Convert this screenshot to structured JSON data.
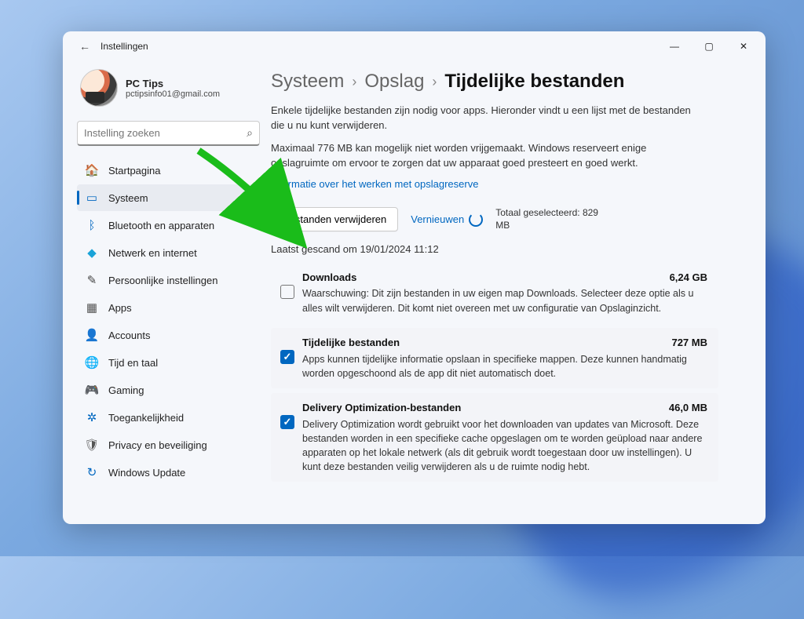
{
  "window": {
    "title": "Instellingen"
  },
  "profile": {
    "name": "PC Tips",
    "email": "pctipsinfo01@gmail.com"
  },
  "search": {
    "placeholder": "Instelling zoeken"
  },
  "nav": [
    {
      "label": "Startpagina",
      "icon": "🏠",
      "color": "#e67e22"
    },
    {
      "label": "Systeem",
      "icon": "▭",
      "color": "#0067c0",
      "selected": true
    },
    {
      "label": "Bluetooth en apparaten",
      "icon": "ᛒ",
      "color": "#0067c0"
    },
    {
      "label": "Netwerk en internet",
      "icon": "◆",
      "color": "#1aa3d8"
    },
    {
      "label": "Persoonlijke instellingen",
      "icon": "✎",
      "color": "#444"
    },
    {
      "label": "Apps",
      "icon": "▦",
      "color": "#555"
    },
    {
      "label": "Accounts",
      "icon": "👤",
      "color": "#2e8b57"
    },
    {
      "label": "Tijd en taal",
      "icon": "🌐",
      "color": "#555"
    },
    {
      "label": "Gaming",
      "icon": "🎮",
      "color": "#555"
    },
    {
      "label": "Toegankelijkheid",
      "icon": "✲",
      "color": "#0067c0"
    },
    {
      "label": "Privacy en beveiliging",
      "icon": "🛡",
      "color": "#555"
    },
    {
      "label": "Windows Update",
      "icon": "↻",
      "color": "#0067c0"
    }
  ],
  "breadcrumb": {
    "p1": "Systeem",
    "p2": "Opslag",
    "current": "Tijdelijke bestanden"
  },
  "intro1": "Enkele tijdelijke bestanden zijn nodig voor apps. Hieronder vindt u een lijst met de bestanden die u nu kunt verwijderen.",
  "intro2": "Maximaal 776 MB kan mogelijk niet worden vrijgemaakt. Windows reserveert enige opslagruimte om ervoor te zorgen dat uw apparaat goed presteert en goed werkt.",
  "reserve_link": "Informatie over het werken met opslagreserve",
  "actions": {
    "remove": "Bestanden verwijderen",
    "refresh": "Vernieuwen",
    "total_label": "Totaal geselecteerd: 829 MB"
  },
  "scan": "Laatst gescand om 19/01/2024 11:12",
  "items": [
    {
      "title": "Downloads",
      "size": "6,24 GB",
      "desc": "Waarschuwing: Dit zijn bestanden in uw eigen map Downloads. Selecteer deze optie als u alles wilt verwijderen. Dit komt niet overeen met uw configuratie van Opslaginzicht.",
      "checked": false
    },
    {
      "title": "Tijdelijke bestanden",
      "size": "727 MB",
      "desc": "Apps kunnen tijdelijke informatie opslaan in specifieke mappen. Deze kunnen handmatig worden opgeschoond als de app dit niet automatisch doet.",
      "checked": true
    },
    {
      "title": "Delivery Optimization-bestanden",
      "size": "46,0 MB",
      "desc": "Delivery Optimization wordt gebruikt voor het downloaden van updates van Microsoft. Deze bestanden worden in een specifieke cache opgeslagen om te worden geüpload naar andere apparaten op het lokale netwerk (als dit gebruik wordt toegestaan door uw instellingen). U kunt deze bestanden veilig verwijderen als u de ruimte nodig hebt.",
      "checked": true
    }
  ]
}
